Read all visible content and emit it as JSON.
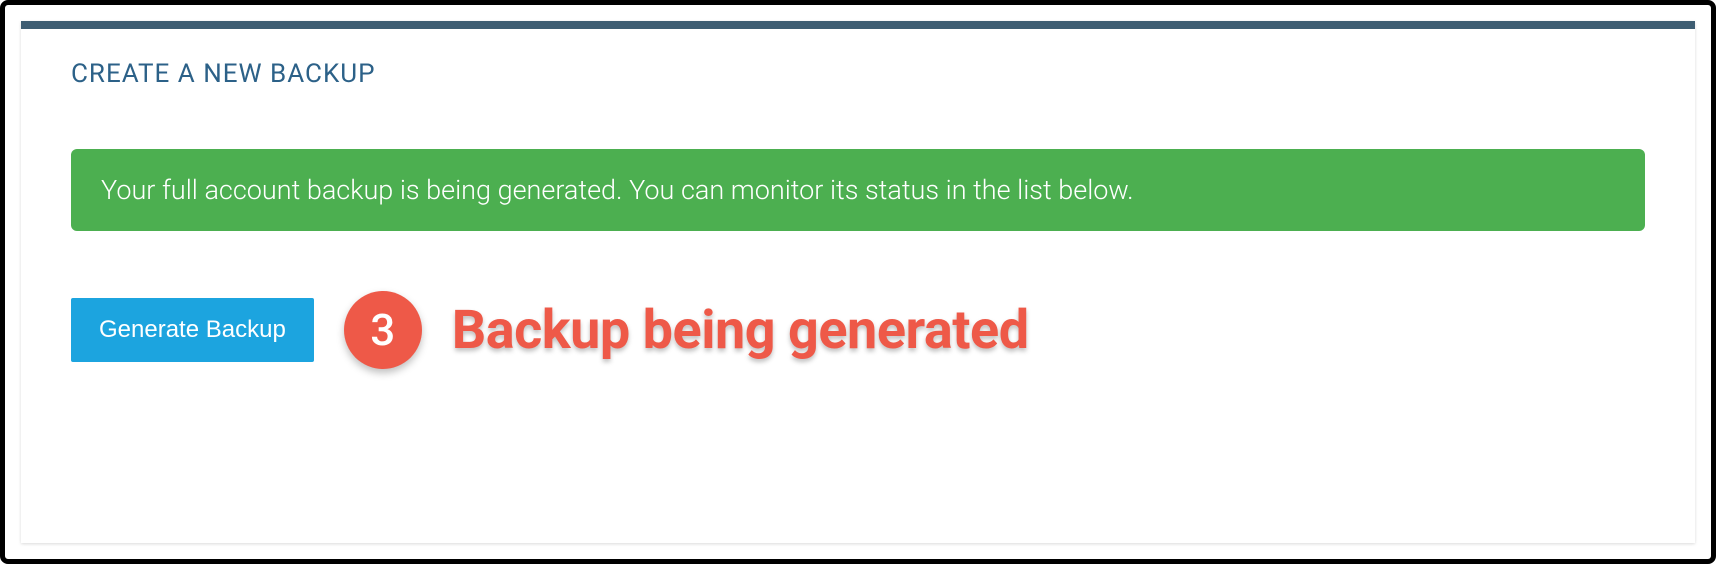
{
  "section": {
    "title": "CREATE A NEW BACKUP"
  },
  "alert": {
    "message": "Your full account backup is being generated. You can monitor its status in the list below."
  },
  "button": {
    "label": "Generate Backup"
  },
  "callout": {
    "number": "3",
    "text": "Backup being generated"
  },
  "colors": {
    "accent": "#1ca4df",
    "success": "#4caf50",
    "callout": "#ee5948",
    "header_bar": "#3e5d72",
    "title": "#2c6188"
  }
}
